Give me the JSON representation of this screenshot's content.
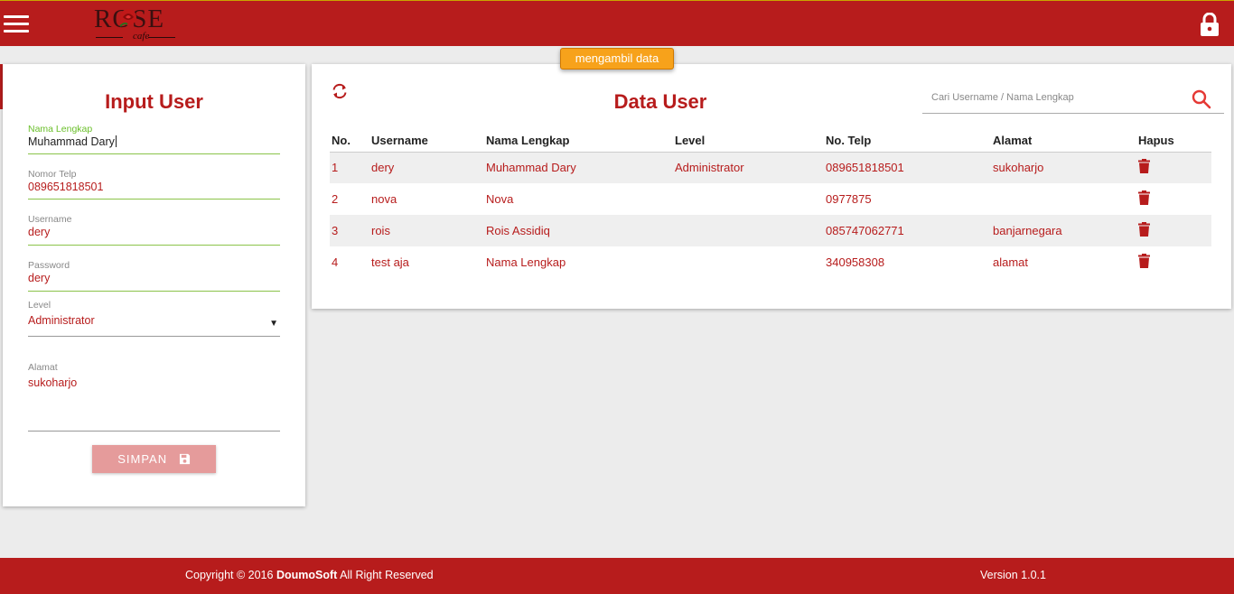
{
  "header": {
    "logo_text": "ROSE",
    "logo_sub": "cafe",
    "brand_color": "#b71c1c"
  },
  "toast": "mengambil data",
  "input_panel": {
    "title": "Input User",
    "fields": {
      "nama_lengkap": {
        "label": "Nama Lengkap",
        "value": "Muhammad Dary"
      },
      "nomor_telp": {
        "label": "Nomor Telp",
        "value": "089651818501"
      },
      "username": {
        "label": "Username",
        "value": "dery"
      },
      "password": {
        "label": "Password",
        "value": "dery"
      },
      "level": {
        "label": "Level",
        "value": "Administrator"
      },
      "alamat": {
        "label": "Alamat",
        "value": "sukoharjo"
      }
    },
    "save_label": "SIMPAN"
  },
  "data_panel": {
    "title": "Data User",
    "search_placeholder": "Cari Username / Nama Lengkap",
    "columns": [
      "No.",
      "Username",
      "Nama Lengkap",
      "Level",
      "No. Telp",
      "Alamat",
      "Hapus"
    ],
    "rows": [
      {
        "no": "1",
        "username": "dery",
        "nama": "Muhammad Dary",
        "level": "Administrator",
        "telp": "089651818501",
        "alamat": "sukoharjo"
      },
      {
        "no": "2",
        "username": "nova",
        "nama": "Nova",
        "level": "",
        "telp": "0977875",
        "alamat": ""
      },
      {
        "no": "3",
        "username": "rois",
        "nama": "Rois Assidiq",
        "level": "",
        "telp": "085747062771",
        "alamat": "banjarnegara"
      },
      {
        "no": "4",
        "username": "test aja",
        "nama": "Nama Lengkap",
        "level": "",
        "telp": "340958308",
        "alamat": "alamat"
      }
    ]
  },
  "footer": {
    "copyright_prefix": "Copyright © 2016",
    "company": "DoumoSoft",
    "copyright_suffix": "All Right Reserved",
    "version": "Version 1.0.1"
  }
}
